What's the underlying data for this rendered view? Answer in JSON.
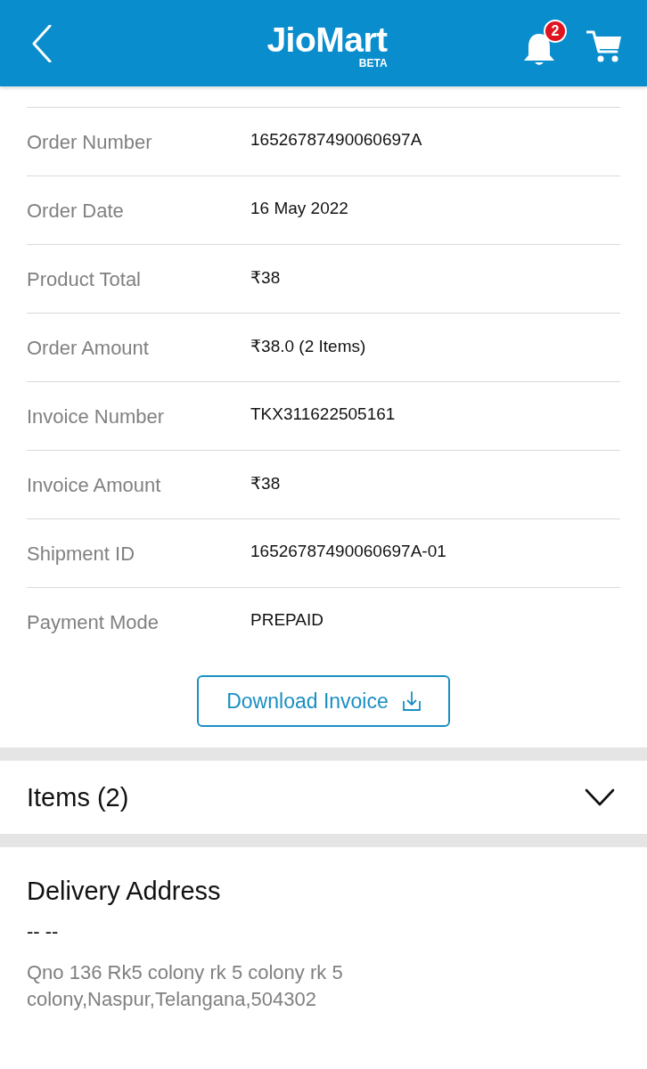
{
  "header": {
    "logo": "JioMart",
    "logo_tag": "BETA",
    "notification_count": "2"
  },
  "order_details": [
    {
      "label": "Order Number",
      "value": "16526787490060697A"
    },
    {
      "label": "Order Date",
      "value": "16 May 2022"
    },
    {
      "label": "Product Total",
      "value": "₹38"
    },
    {
      "label": "Order Amount",
      "value": "₹38.0 (2 Items)"
    },
    {
      "label": "Invoice Number",
      "value": "TKX311622505161"
    },
    {
      "label": "Invoice Amount",
      "value": "₹38"
    },
    {
      "label": "Shipment ID",
      "value": "16526787490060697A-01"
    },
    {
      "label": "Payment Mode",
      "value": "PREPAID"
    }
  ],
  "download_button": {
    "label": "Download Invoice"
  },
  "items_section": {
    "title": "Items (2)",
    "expanded": false
  },
  "delivery_address": {
    "title": "Delivery Address",
    "name": "-- --",
    "address": "Qno 136 Rk5 colony rk 5 colony rk 5 colony,Naspur,Telangana,504302"
  }
}
